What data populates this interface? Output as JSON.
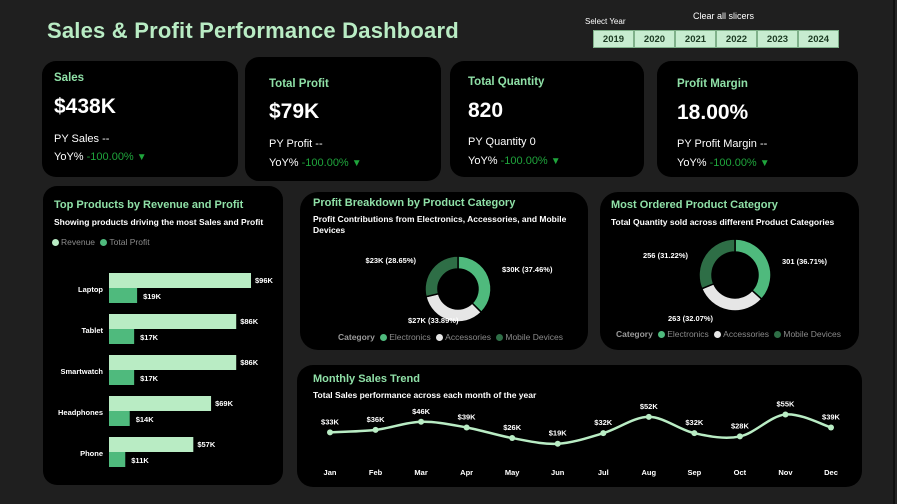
{
  "header": {
    "title": "Sales & Profit Performance Dashboard",
    "select_year_label": "Select Year",
    "clear_label": "Clear all slicers",
    "years": [
      "2019",
      "2020",
      "2021",
      "2022",
      "2023",
      "2024"
    ]
  },
  "kpis": [
    {
      "title": "Sales",
      "value": "$438K",
      "py_label": "PY Sales",
      "py_value": "--",
      "yoy_label": "YoY%",
      "yoy_value": "-100.00%"
    },
    {
      "title": "Total Profit",
      "value": "$79K",
      "py_label": "PY Profit",
      "py_value": "--",
      "yoy_label": "YoY%",
      "yoy_value": "-100.00%"
    },
    {
      "title": "Total Quantity",
      "value": "820",
      "py_label": "PY Quantity",
      "py_value": "0",
      "yoy_label": "YoY%",
      "yoy_value": "-100.00%"
    },
    {
      "title": "Profit Margin",
      "value": "18.00%",
      "py_label": "PY Profit Margin",
      "py_value": "--",
      "yoy_label": "YoY%",
      "yoy_value": "-100.00%"
    }
  ],
  "colors": {
    "accent_title": "#8fe0a7",
    "revenue": "#b9ecc4",
    "profit": "#4fba7d",
    "electronics": "#4fba7d",
    "accessories": "#e6e6e6",
    "mobile_devices": "#2e6e46",
    "negative": "#1fa53c"
  },
  "top_products": {
    "title": "Top Products by Revenue and Profit",
    "subtitle": "Showing products driving the most Sales and Profit",
    "legend": [
      "Revenue",
      "Total Profit"
    ],
    "chart_data": {
      "type": "bar",
      "orientation": "horizontal",
      "categories": [
        "Laptop",
        "Tablet",
        "Smartwatch",
        "Headphones",
        "Phone"
      ],
      "series": [
        {
          "name": "Revenue",
          "values": [
            96,
            86,
            86,
            69,
            57
          ],
          "labels": [
            "$96K",
            "$86K",
            "$86K",
            "$69K",
            "$57K"
          ]
        },
        {
          "name": "Total Profit",
          "values": [
            19,
            17,
            17,
            14,
            11
          ],
          "labels": [
            "$19K",
            "$17K",
            "$17K",
            "$14K",
            "$11K"
          ]
        }
      ]
    }
  },
  "profit_breakdown": {
    "title": "Profit Breakdown by Product Category",
    "subtitle": "Profit Contributions from Electronics, Accessories, and Mobile Devices",
    "legend_title": "Category",
    "legend": [
      "Electronics",
      "Accessories",
      "Mobile Devices"
    ],
    "chart_data": {
      "type": "pie",
      "donut": true,
      "categories": [
        "Electronics",
        "Accessories",
        "Mobile Devices"
      ],
      "values": [
        30,
        27,
        23
      ],
      "labels": [
        "$30K (37.46%)",
        "$27K (33.89%)",
        "$23K (28.65%)"
      ]
    }
  },
  "most_ordered": {
    "title": "Most Ordered Product Category",
    "subtitle": "Total Quantity sold across different Product Categories",
    "legend_title": "Category",
    "legend": [
      "Electronics",
      "Accessories",
      "Mobile Devices"
    ],
    "chart_data": {
      "type": "pie",
      "donut": true,
      "categories": [
        "Electronics",
        "Accessories",
        "Mobile Devices"
      ],
      "values": [
        301,
        263,
        256
      ],
      "labels": [
        "301 (36.71%)",
        "263 (32.07%)",
        "256 (31.22%)"
      ]
    }
  },
  "monthly_trend": {
    "title": "Monthly Sales Trend",
    "subtitle": "Total Sales performance across each month of the year",
    "chart_data": {
      "type": "line",
      "categories": [
        "Jan",
        "Feb",
        "Mar",
        "Apr",
        "May",
        "Jun",
        "Jul",
        "Aug",
        "Sep",
        "Oct",
        "Nov",
        "Dec"
      ],
      "values": [
        33,
        36,
        46,
        39,
        26,
        19,
        32,
        52,
        32,
        28,
        55,
        39
      ],
      "labels": [
        "$33K",
        "$36K",
        "$46K",
        "$39K",
        "$26K",
        "$19K",
        "$32K",
        "$52K",
        "$32K",
        "$28K",
        "$55K",
        "$39K"
      ]
    }
  }
}
